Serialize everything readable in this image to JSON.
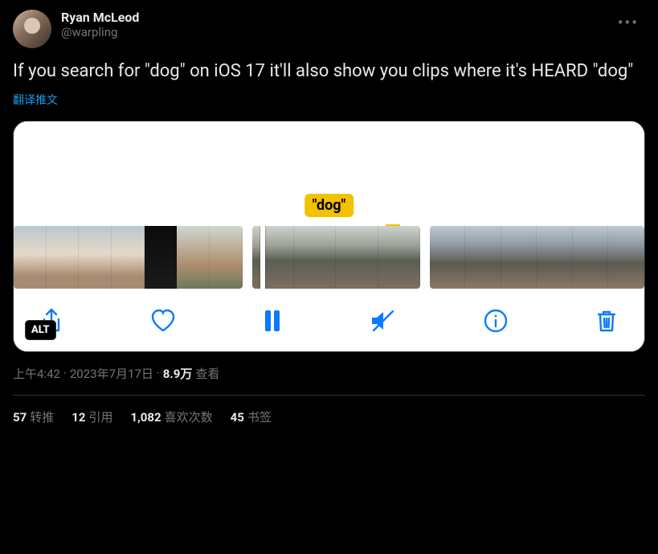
{
  "author": {
    "display_name": "Ryan McLeod",
    "handle": "@warpling"
  },
  "tweet_text": "If you search for \"dog\" on iOS 17 it'll also show you clips where it's HEARD \"dog\"",
  "translate_label": "翻译推文",
  "media": {
    "search_term_label": "\"dog\"",
    "alt_badge": "ALT"
  },
  "meta": {
    "time": "上午4:42",
    "dot1": " · ",
    "date": "2023年7月17日",
    "dot2": " · ",
    "views_count": "8.9万",
    "views_label": " 查看"
  },
  "stats": {
    "retweets_count": "57",
    "retweets_label": "转推",
    "quotes_count": "12",
    "quotes_label": "引用",
    "likes_count": "1,082",
    "likes_label": "喜欢次数",
    "bookmarks_count": "45",
    "bookmarks_label": "书签"
  }
}
